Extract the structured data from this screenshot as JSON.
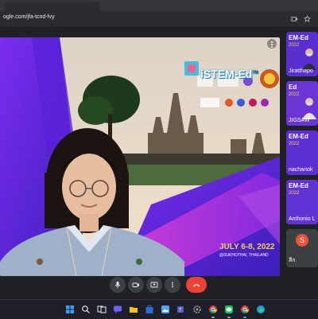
{
  "browser": {
    "url": "ogle.com/jfa-tcnd-fvy"
  },
  "stage": {
    "logo_text": "iSTEM-Ed",
    "logo_tm": "TM",
    "date_text": "JULY 6-8, 2022",
    "location_text": "@SUKHOTHAI, THAILAND"
  },
  "sidebar": {
    "tiles": [
      {
        "banner": "EM-Ed",
        "year": "2022",
        "name": "Jiratthapo",
        "color": "#5a2fcf"
      },
      {
        "banner": "Ed",
        "year": "2022",
        "name": "JIGSAW",
        "color": "#6b35d6"
      },
      {
        "banner": "EM-Ed",
        "year": "2022",
        "name": "nachanok",
        "color": "#5e2fd2"
      },
      {
        "banner": "EM-Ed",
        "year": "2022",
        "name": "Anthonio L",
        "color": "#6233d4"
      },
      {
        "banner": "S",
        "year": "",
        "name": "ลีก",
        "color": "#3c4043"
      }
    ]
  },
  "controls": {
    "mic_icon": "mic-icon",
    "camera_icon": "camera-icon",
    "present_icon": "present-icon",
    "more_icon": "more-icon",
    "hangup_icon": "hang-up-icon",
    "hangup_color": "#ea4335"
  },
  "taskbar": {
    "icons": [
      "windows-icon",
      "search-icon",
      "task-view-icon",
      "chat-icon",
      "file-explorer-icon",
      "store-icon",
      "photos-icon",
      "teams-icon",
      "settings-icon",
      "chrome-icon",
      "line-icon",
      "chrome-icon",
      "edge-icon"
    ]
  }
}
